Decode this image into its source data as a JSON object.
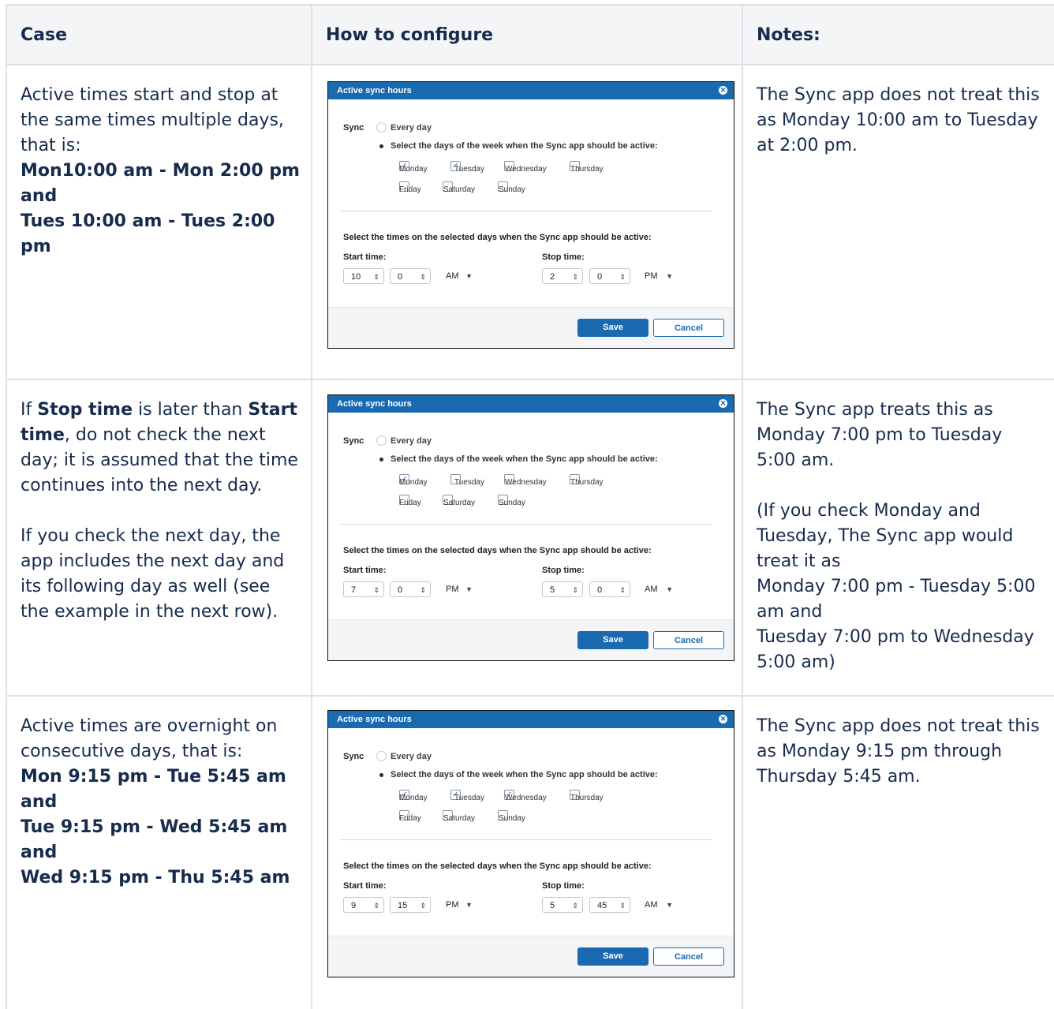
{
  "headers": {
    "case": "Case",
    "how": "How to configure",
    "notes": "Notes:"
  },
  "dialog_common": {
    "title": "Active sync hours",
    "sync_label": "Sync",
    "every_day": "Every day",
    "select_days": "Select the days of the week when the Sync app should be active:",
    "days": [
      "Monday",
      "Tuesday",
      "Wednesday",
      "Thursday",
      "Friday",
      "Saturday",
      "Sunday"
    ],
    "select_times": "Select the times on the selected days when the Sync app should be active:",
    "start_label": "Start time:",
    "stop_label": "Stop time:",
    "save": "Save",
    "cancel": "Cancel",
    "close_icon": "close-icon"
  },
  "rows": [
    {
      "case": {
        "line1": "Active times start and stop at the same times multiple days, that is:",
        "bold1": "Mon10:00 am - Mon 2:00 pm",
        "bold2": "and",
        "bold3": "Tues 10:00 am - Tues 2:00 pm"
      },
      "dialog": {
        "checked": [
          true,
          true,
          false,
          false,
          false,
          false,
          false
        ],
        "start": [
          "10",
          "0",
          "AM"
        ],
        "stop": [
          "2",
          "0",
          "PM"
        ]
      },
      "notes": {
        "p1": "The Sync app does not treat this as Monday 10:00 am to Tuesday at 2:00 pm."
      }
    },
    {
      "case": {
        "pre1": "If ",
        "bold_stop": "Stop time",
        "mid1": " is later than ",
        "bold_start": "Start time",
        "post1": ", do not check the next day; it is assumed that the time continues into the next day.",
        "p2": "If you check the next day, the app includes the next day and its following day as well (see the example in the next row)."
      },
      "dialog": {
        "checked": [
          true,
          false,
          false,
          false,
          false,
          false,
          false
        ],
        "start": [
          "7",
          "0",
          "PM"
        ],
        "stop": [
          "5",
          "0",
          "AM"
        ]
      },
      "notes": {
        "p1": "The Sync app treats this as Monday 7:00 pm to Tuesday 5:00 am.",
        "p2a": "(If you check Monday and Tuesday, The Sync app would treat it as",
        "p2b": "Monday 7:00 pm - Tuesday 5:00 am and",
        "p2c": "Tuesday 7:00 pm to Wednesday 5:00 am)"
      }
    },
    {
      "case": {
        "line1": "Active times are overnight on consecutive days, that is:",
        "bold1": "Mon 9:15 pm - Tue 5:45 am",
        "bold2": "and",
        "bold3": "Tue 9:15 pm - Wed 5:45 am",
        "bold4": "and",
        "bold5": "Wed 9:15 pm - Thu 5:45 am"
      },
      "dialog": {
        "checked": [
          true,
          true,
          true,
          false,
          false,
          false,
          false
        ],
        "start": [
          "9",
          "15",
          "PM"
        ],
        "stop": [
          "5",
          "45",
          "AM"
        ]
      },
      "notes": {
        "p1": "The Sync app does not treat this as Monday 9:15 pm through Thursday 5:45 am."
      }
    }
  ]
}
